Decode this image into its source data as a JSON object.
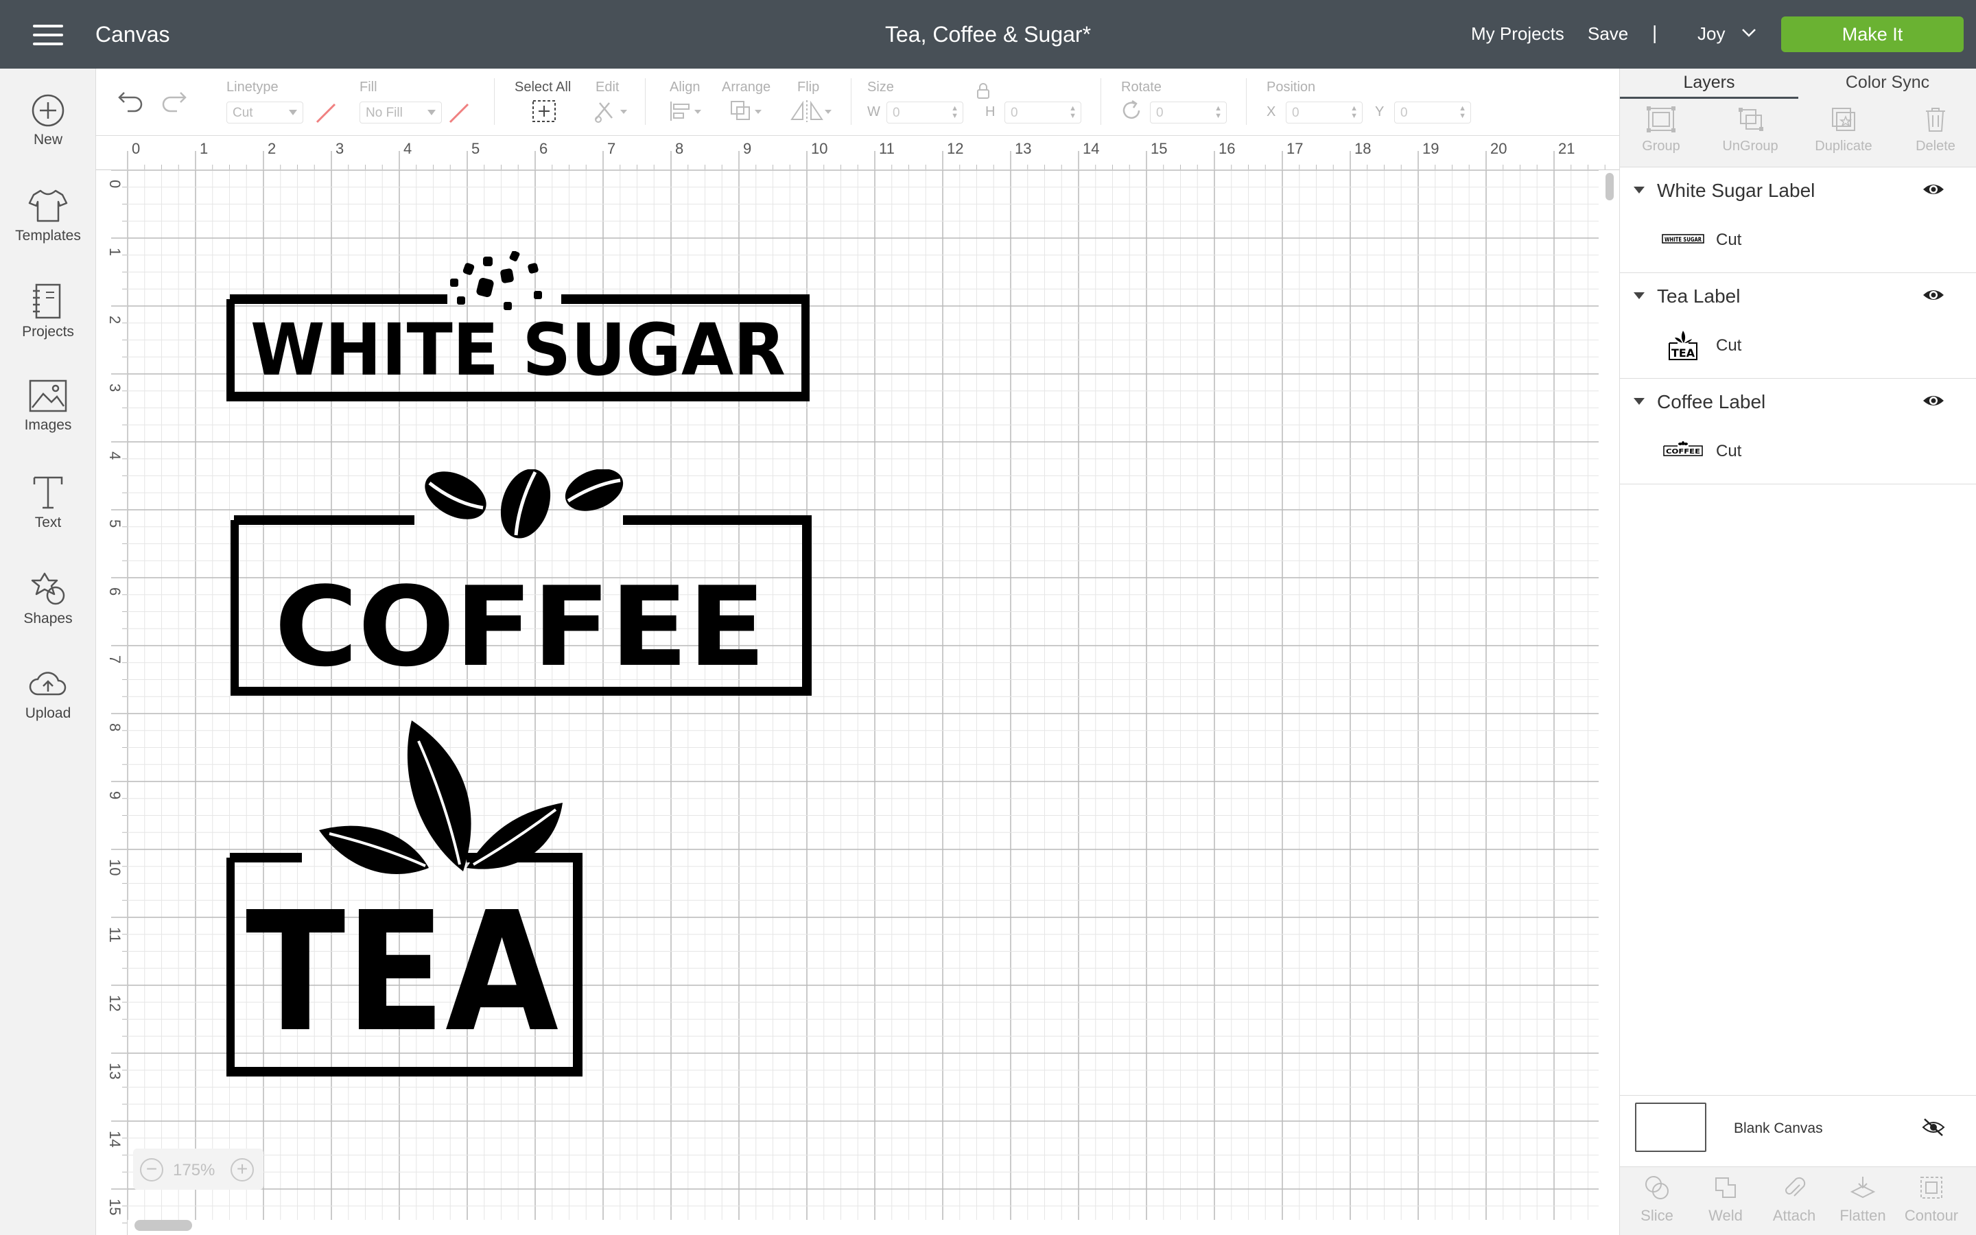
{
  "header": {
    "app_title": "Canvas",
    "doc_title": "Tea, Coffee & Sugar*",
    "my_projects": "My Projects",
    "save": "Save",
    "separator": "|",
    "user": "Joy",
    "make_it": "Make It",
    "accent_color": "#6ab232",
    "bar_color": "#485057"
  },
  "sidebar": {
    "items": [
      {
        "label": "New",
        "icon": "plus-circle-icon"
      },
      {
        "label": "Templates",
        "icon": "tshirt-icon"
      },
      {
        "label": "Projects",
        "icon": "notebook-icon"
      },
      {
        "label": "Images",
        "icon": "image-icon"
      },
      {
        "label": "Text",
        "icon": "text-icon"
      },
      {
        "label": "Shapes",
        "icon": "shapes-icon"
      },
      {
        "label": "Upload",
        "icon": "cloud-upload-icon"
      }
    ]
  },
  "toolbar": {
    "linetype_label": "Linetype",
    "linetype_value": "Cut",
    "fill_label": "Fill",
    "fill_value": "No Fill",
    "select_all": "Select All",
    "edit_label": "Edit",
    "align_label": "Align",
    "arrange_label": "Arrange",
    "flip_label": "Flip",
    "size_label": "Size",
    "w_label": "W",
    "w_value": "0",
    "h_label": "H",
    "h_value": "0",
    "rotate_label": "Rotate",
    "rotate_value": "0",
    "position_label": "Position",
    "x_label": "X",
    "x_value": "0",
    "y_label": "Y",
    "y_value": "0"
  },
  "ruler": {
    "top": [
      "0",
      "1",
      "2",
      "3",
      "4",
      "5",
      "6",
      "7",
      "8",
      "9",
      "10",
      "11",
      "12",
      "13",
      "14",
      "15",
      "16",
      "17",
      "18",
      "19",
      "20",
      "21"
    ],
    "left": [
      "0",
      "1",
      "2",
      "3",
      "4",
      "5",
      "6",
      "7",
      "8",
      "9",
      "10",
      "11",
      "12",
      "13",
      "14",
      "15"
    ]
  },
  "canvas": {
    "zoom": "175%",
    "zoom_out": "−",
    "zoom_in": "+",
    "labels": {
      "sugar": "WHITE SUGAR",
      "coffee": "COFFEE",
      "tea": "TEA"
    }
  },
  "panel": {
    "tabs": [
      "Layers",
      "Color Sync"
    ],
    "actions": [
      "Group",
      "UnGroup",
      "Duplicate",
      "Delete"
    ],
    "layers": [
      {
        "name": "White Sugar Label",
        "operation": "Cut",
        "thumb_text": "WHITE SUGAR"
      },
      {
        "name": "Tea Label",
        "operation": "Cut",
        "thumb_text": "TEA"
      },
      {
        "name": "Coffee Label",
        "operation": "Cut",
        "thumb_text": "COFFEE"
      }
    ],
    "blank_canvas": "Blank Canvas",
    "bottom_actions": [
      "Slice",
      "Weld",
      "Attach",
      "Flatten",
      "Contour"
    ]
  }
}
